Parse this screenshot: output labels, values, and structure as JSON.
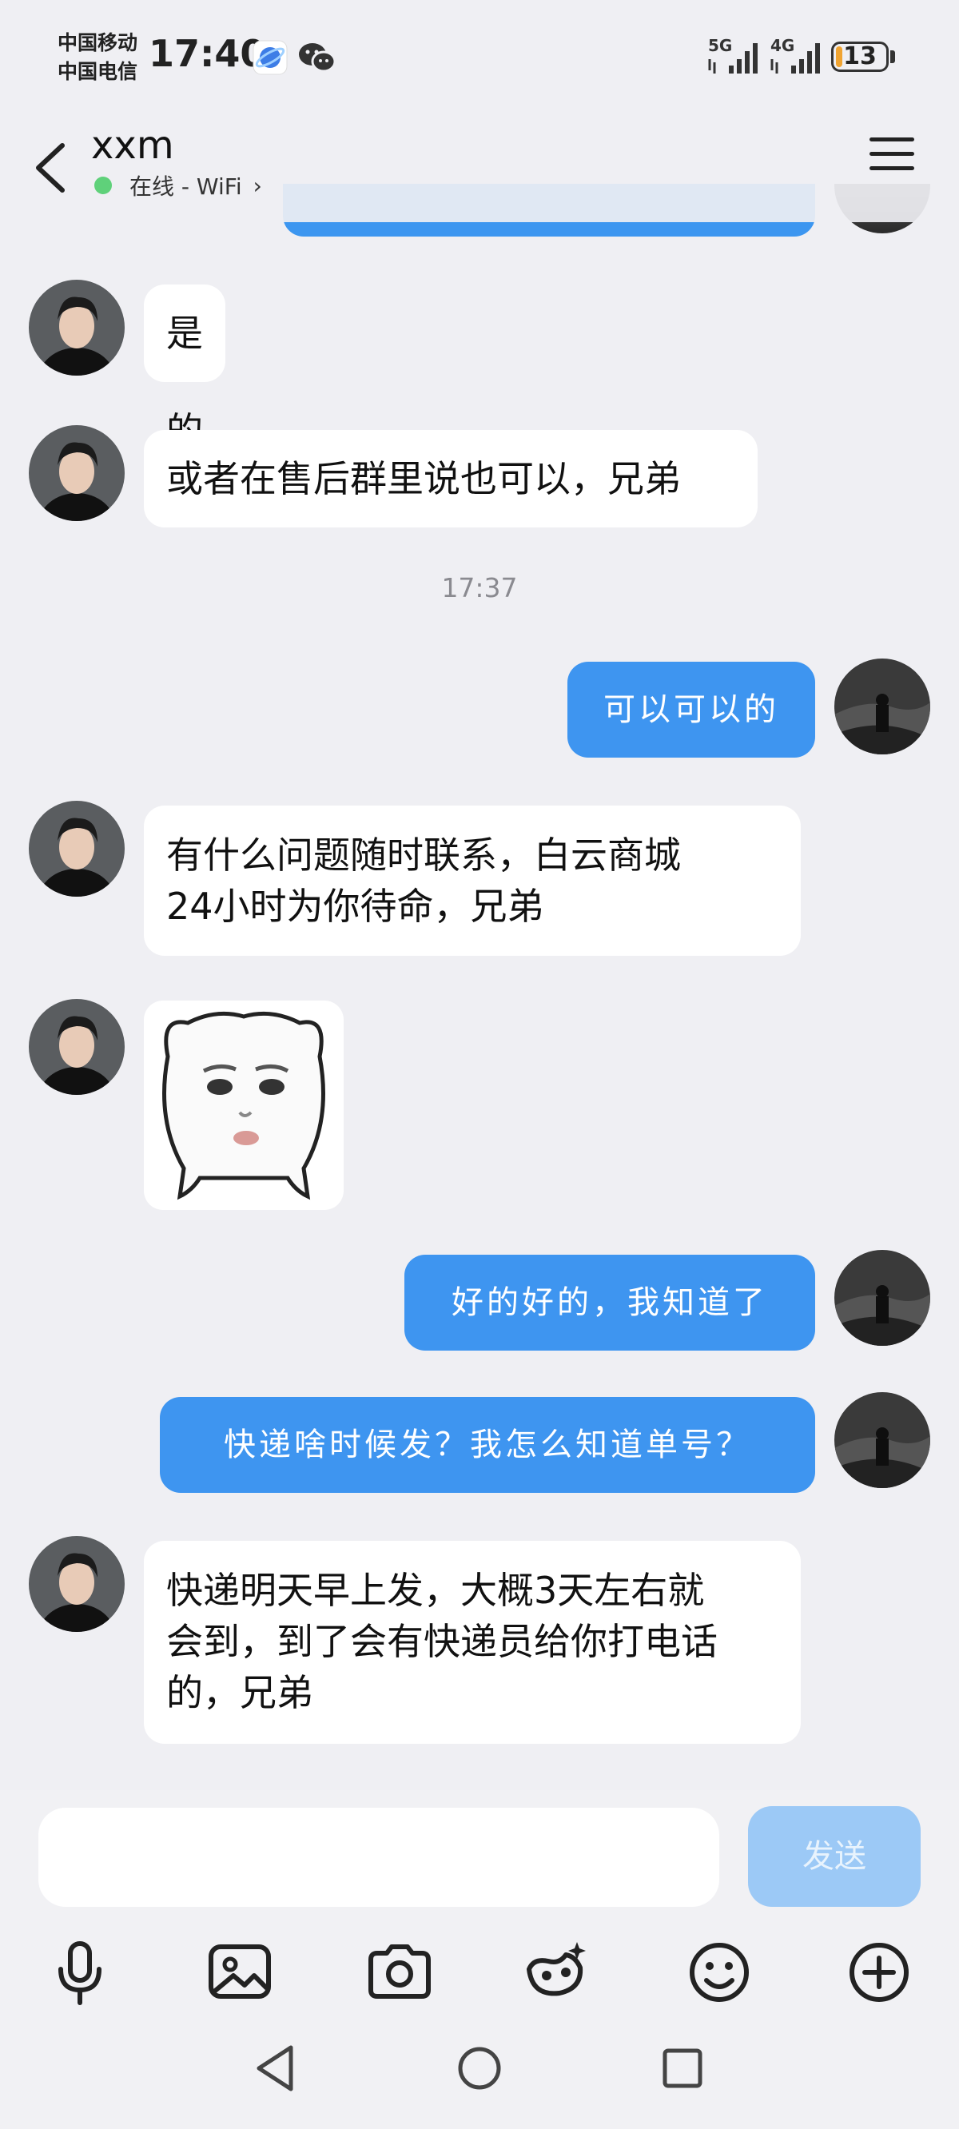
{
  "status_bar": {
    "carrier_1": "中国移动",
    "carrier_2": "中国电信",
    "time": "17:40",
    "network_1": "5G",
    "network_2": "4G",
    "battery": "13",
    "battery_level_percent": 13,
    "icons": [
      "browser-icon",
      "wechat-icon",
      "signal-icon",
      "battery-icon"
    ]
  },
  "header": {
    "title": "xxm",
    "presence": "在线 - WiFi",
    "presence_color": "#5fd17a"
  },
  "messages": [
    {
      "side": "in",
      "text": "是的"
    },
    {
      "side": "in",
      "text": "或者在售后群里说也可以，兄弟"
    },
    {
      "type": "timestamp",
      "text": "17:37"
    },
    {
      "side": "out",
      "text": "可以可以的"
    },
    {
      "side": "in",
      "text": "有什么问题随时联系，白云商城\n24小时为你待命，兄弟"
    },
    {
      "side": "in",
      "type": "sticker",
      "sticker": "bear-face-sticker"
    },
    {
      "side": "out",
      "text": "好的好的，我知道了"
    },
    {
      "side": "out",
      "text": "快递啥时候发？我怎么知道单号？"
    },
    {
      "side": "in",
      "text": "快递明天早上发，大概3天左右就\n会到，到了会有快递员给你打电话\n的，兄弟"
    }
  ],
  "composer": {
    "input_value": "",
    "send_label": "发送"
  },
  "colors": {
    "outgoing_bubble": "#3e95f0",
    "incoming_bubble": "#ffffff",
    "background": "#efeff3",
    "send_disabled": "#9cc9f6"
  }
}
